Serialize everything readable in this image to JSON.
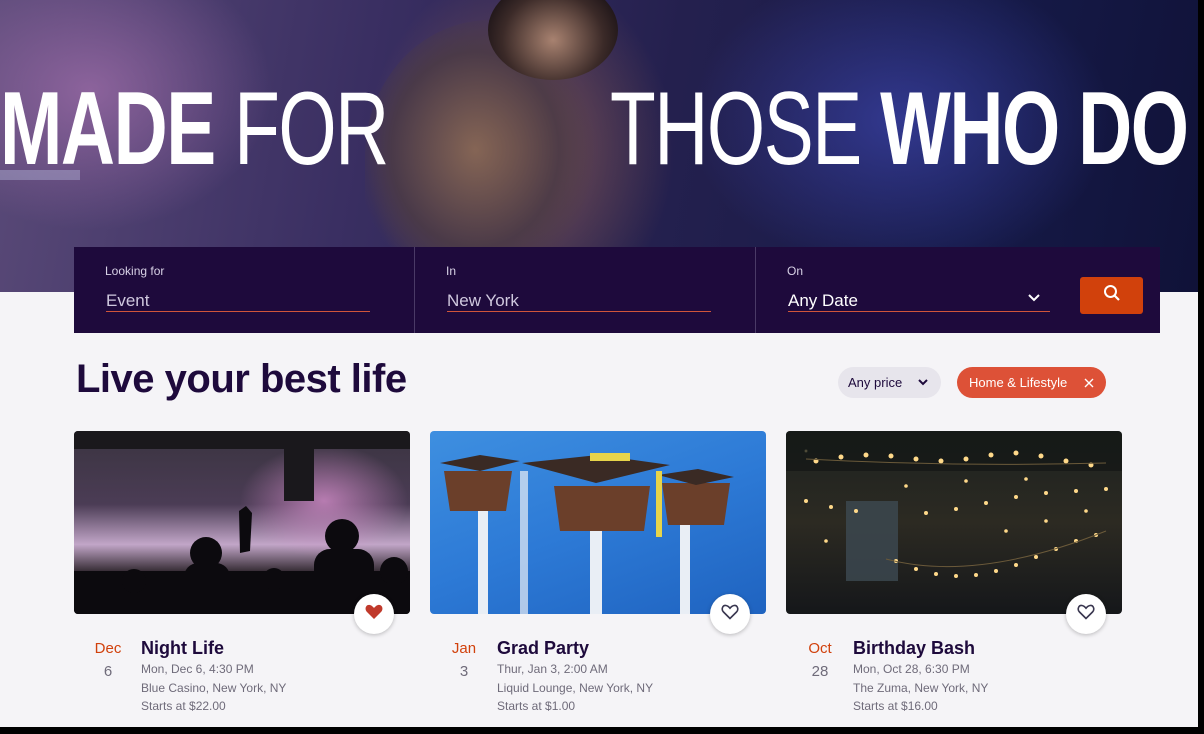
{
  "hero": {
    "headline_part1_bold": "MADE",
    "headline_part1_thin": " FOR",
    "headline_part2_thin": "THOSE ",
    "headline_part2_bold": "WHO DO"
  },
  "search": {
    "looking_for_label": "Looking for",
    "looking_for_value": "Event",
    "in_label": "In",
    "in_value": "New York",
    "on_label": "On",
    "on_value": "Any Date",
    "button_icon": "search-icon"
  },
  "section": {
    "title": "Live your best life",
    "price_filter": "Any price",
    "category_filter": "Home & Lifestyle"
  },
  "events": [
    {
      "month": "Dec",
      "day": "6",
      "title": "Night Life",
      "datetime": "Mon, Dec 6, 4:30 PM",
      "venue": "Blue Casino, New York, NY",
      "price": "Starts at $22.00",
      "favorited": true
    },
    {
      "month": "Jan",
      "day": "3",
      "title": "Grad Party",
      "datetime": "Thur, Jan 3, 2:00 AM",
      "venue": "Liquid Lounge, New York, NY",
      "price": "Starts at $1.00",
      "favorited": false
    },
    {
      "month": "Oct",
      "day": "28",
      "title": "Birthday Bash",
      "datetime": "Mon, Oct 28, 6:30 PM",
      "venue": "The Zuma, New York, NY",
      "price": "Starts at $16.00",
      "favorited": false
    }
  ],
  "colors": {
    "brand_dark": "#1e0a3c",
    "accent": "#d1410c",
    "chip_active": "#dd5137"
  }
}
